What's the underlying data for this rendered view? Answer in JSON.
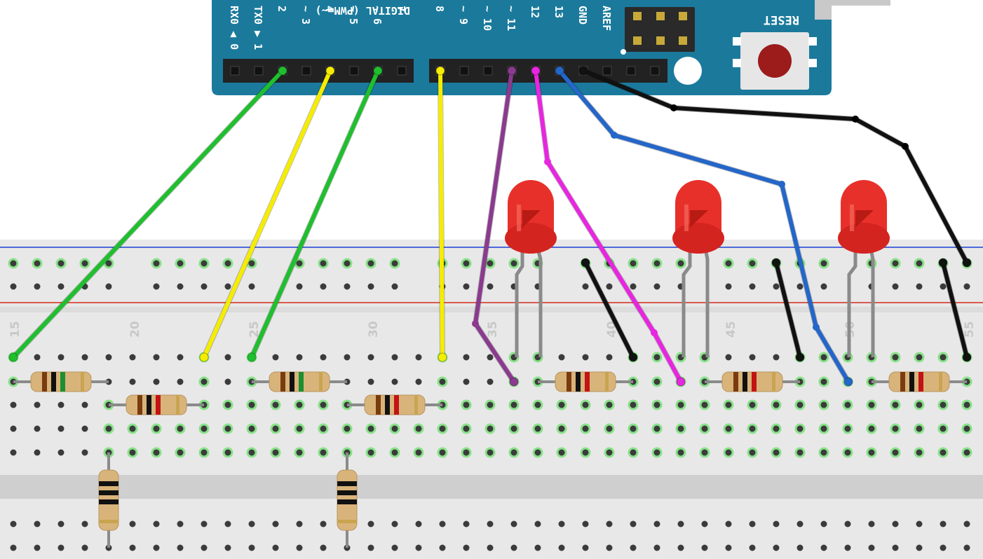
{
  "colors": {
    "board": "#1B7A9C",
    "board_dark": "#156683",
    "header": "#222222",
    "breadboard": "#e8e8e8",
    "breadboard_gap": "#cfcfcf",
    "rail_blue": "#1a3fd6",
    "rail_red": "#d42a1a",
    "hole": "#3b3b3b",
    "hole_active": "#7ee07e",
    "led_red": "#e8302a",
    "lead": "#8a8a8a",
    "resistor_body": "#d9b47a",
    "wire_green": "#1fbf2e",
    "wire_yellow": "#f5ec00",
    "wire_purple": "#8b3a8f",
    "wire_magenta": "#e825e0",
    "wire_blue": "#2466c9",
    "wire_black": "#111111",
    "reset_button": "#9c1b1b"
  },
  "arduino": {
    "top_label": "DIGITAL (PWM=~)",
    "reset_label": "RESET",
    "pins_left": [
      "RX0 ◀ 0",
      "TX0 ▶ 1",
      "2",
      "~ 3",
      "4",
      "~ 5",
      "~ 6",
      "7"
    ],
    "pins_right": [
      "8",
      "~ 9",
      "~ 10",
      "~ 11",
      "12",
      "13",
      "GND",
      "AREF"
    ]
  },
  "breadboard": {
    "column_numbers": [
      "15",
      "20",
      "25",
      "30",
      "35",
      "40",
      "45",
      "50",
      "55"
    ]
  },
  "components": {
    "leds": [
      "red-led",
      "red-led",
      "red-led"
    ],
    "resistors": [
      "resistor",
      "resistor",
      "resistor",
      "resistor",
      "resistor",
      "resistor",
      "resistor",
      "resistor",
      "resistor"
    ]
  },
  "wires": [
    {
      "color": "wire_green"
    },
    {
      "color": "wire_yellow"
    },
    {
      "color": "wire_green"
    },
    {
      "color": "wire_yellow"
    },
    {
      "color": "wire_purple"
    },
    {
      "color": "wire_magenta"
    },
    {
      "color": "wire_blue"
    },
    {
      "color": "wire_black"
    },
    {
      "color": "wire_black"
    },
    {
      "color": "wire_black"
    },
    {
      "color": "wire_black"
    }
  ]
}
